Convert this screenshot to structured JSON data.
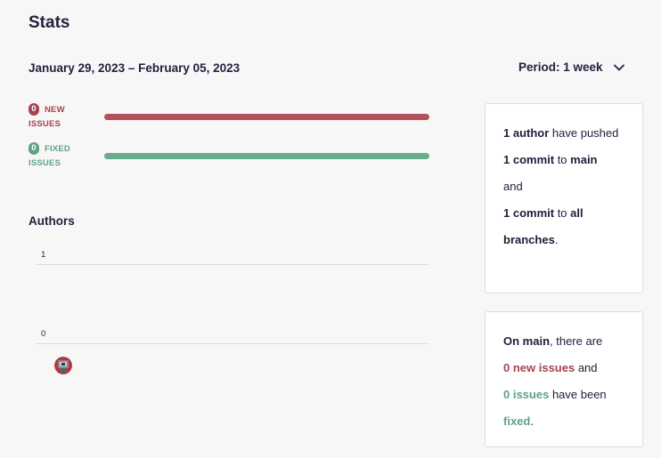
{
  "header": {
    "title": "Stats",
    "date_range": "January 29, 2023 – February 05, 2023",
    "period_label": "Period: 1 week"
  },
  "issues": {
    "new": {
      "count": "0",
      "label": "NEW ISSUES",
      "color": "#a8424f"
    },
    "fixed": {
      "count": "0",
      "label": "FIXED ISSUES",
      "color": "#5da382"
    }
  },
  "authors_chart": {
    "heading": "Authors",
    "y_ticks": [
      "1",
      "0"
    ]
  },
  "authors_card": {
    "line1_bold": "1 author",
    "line1_rest": " have pushed",
    "line2_bold": "1 commit",
    "line2_mid": " to ",
    "line2_branch": "main",
    "line3": " and ",
    "line4_bold": "1 commit",
    "line4_mid": " to ",
    "line4_branch": "all branches",
    "line4_end": "."
  },
  "main_card": {
    "prefix_bold": "On main",
    "prefix_rest": ", there are ",
    "new_issues": "0 new issues",
    "and_text": " and ",
    "fixed_issues": "0 issues",
    "been_text": " have been ",
    "fixed_word": "fixed",
    "end": "."
  },
  "colors": {
    "accent_red": "#a8424f",
    "accent_green": "#5da382",
    "text_dark": "#23213f"
  }
}
